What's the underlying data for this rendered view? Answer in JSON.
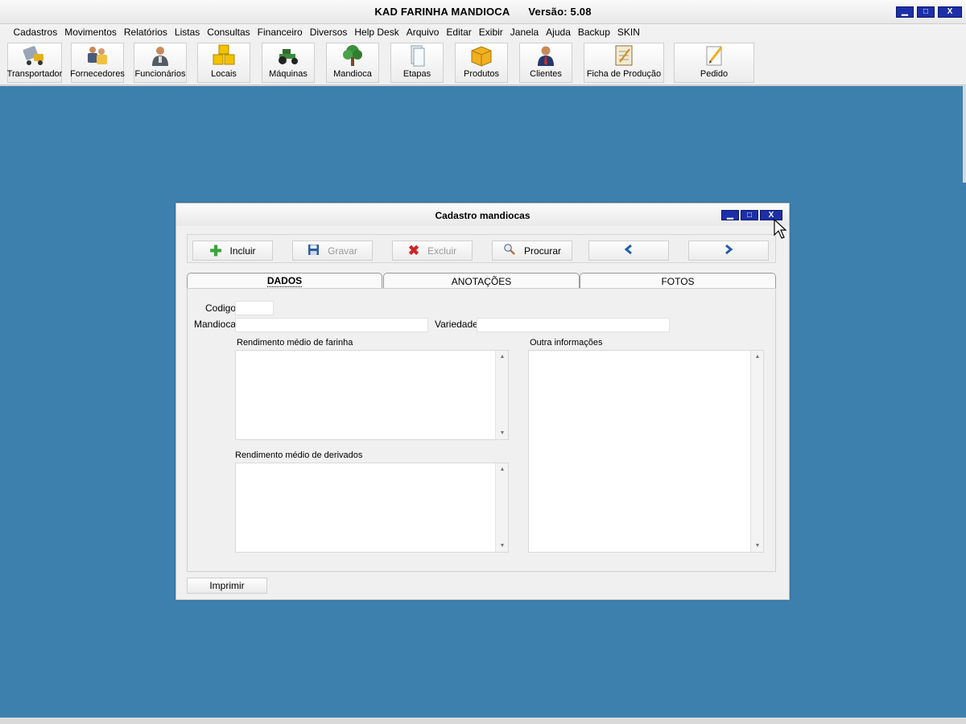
{
  "app": {
    "title": "KAD FARINHA MANDIOCA",
    "version": "Versão: 5.08",
    "window_controls": {
      "minimize": "_",
      "maximize": "□",
      "close": "X"
    }
  },
  "menu": [
    "Cadastros",
    "Movimentos",
    "Relatórios",
    "Listas",
    "Consultas",
    "Financeiro",
    "Diversos",
    "Help Desk",
    "Arquivo",
    "Editar",
    "Exibir",
    "Janela",
    "Ajuda",
    "Backup",
    "SKIN"
  ],
  "toolbar": [
    {
      "label": "Transportador",
      "icon": "truck-icon"
    },
    {
      "label": "Fornecedores",
      "icon": "suppliers-icon"
    },
    {
      "label": "Funcionários",
      "icon": "employee-icon"
    },
    {
      "label": "Locais",
      "icon": "boxes-icon"
    },
    {
      "label": "Máquinas",
      "icon": "tractor-icon"
    },
    {
      "label": "Mandioca",
      "icon": "tree-icon"
    },
    {
      "label": "Etapas",
      "icon": "pages-icon"
    },
    {
      "label": "Produtos",
      "icon": "box-icon"
    },
    {
      "label": "Clientes",
      "icon": "client-icon"
    },
    {
      "label": "Ficha de Produção",
      "icon": "notepad-icon"
    },
    {
      "label": "Pedido",
      "icon": "order-icon"
    }
  ],
  "dialog": {
    "title": "Cadastro mandiocas",
    "actions": {
      "incluir": "Incluir",
      "gravar": "Gravar",
      "excluir": "Excluir",
      "procurar": "Procurar",
      "prev": "◀",
      "next": "▶"
    },
    "tabs": {
      "dados": "DADOS",
      "anotacoes": "ANOTAÇÕES",
      "fotos": "FOTOS"
    },
    "fields": {
      "codigo_label": "Codigo",
      "codigo_value": "",
      "mandioca_label": "Mandioca",
      "mandioca_value": "",
      "variedade_label": "Variedade",
      "variedade_value": "",
      "rend_farinha_label": "Rendimento médio de farinha",
      "rend_derivados_label": "Rendimento médio de derivados",
      "outras_label": "Outra informações"
    },
    "print": "Imprimir"
  },
  "colors": {
    "desktop": "#3d80ae",
    "winctrl": "#1c2fa8",
    "nav_arrow": "#1f5fae",
    "add_green": "#3aa33a",
    "delete_red": "#d02525"
  }
}
